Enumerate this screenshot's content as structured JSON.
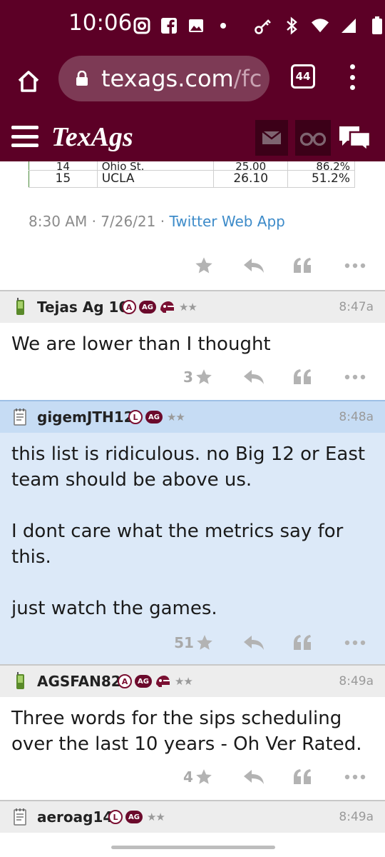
{
  "status_bar": {
    "time": "10:06",
    "left_icons": [
      "instagram-icon",
      "facebook-icon",
      "image-icon",
      "dot-icon"
    ],
    "right_icons": [
      "key-icon",
      "bluetooth-icon",
      "wifi-icon",
      "signal-icon",
      "battery-icon"
    ]
  },
  "browser": {
    "url_host": "texags.com",
    "url_path": "/fc",
    "tab_count": "44"
  },
  "app_bar": {
    "logo": "TexAgs"
  },
  "tweet": {
    "table_rows": [
      {
        "rank": "14",
        "team": "Ohio St.",
        "score": "25.00",
        "pct": "86.2%"
      },
      {
        "rank": "15",
        "team": "UCLA",
        "score": "26.10",
        "pct": "51.2%"
      }
    ],
    "timestamp": "8:30 AM · 7/26/21 · ",
    "source": "Twitter Web App"
  },
  "posts": [
    {
      "username": "Tejas Ag 10",
      "badge_letter": "A",
      "badge_ag": "AG",
      "stars": "★★",
      "time": "8:47a",
      "body": [
        "We are lower than I thought"
      ],
      "star_count": "3"
    },
    {
      "username": "gigemJTH12",
      "badge_letter": "L",
      "badge_ag": "AG",
      "stars": "★★",
      "time": "8:48a",
      "body": [
        "this list is ridiculous. no Big 12 or East team should be above us.",
        "I dont care what the metrics say for this.",
        "just watch the games."
      ],
      "star_count": "51"
    },
    {
      "username": "AGSFAN82",
      "badge_letter": "A",
      "badge_ag": "AG",
      "stars": "★★",
      "time": "8:49a",
      "body": [
        "Three words for the sips scheduling over the last 10 years - Oh Ver Rated."
      ],
      "star_count": "4"
    },
    {
      "username": "aeroag14",
      "badge_letter": "L",
      "badge_ag": "AG",
      "stars": "★★",
      "time": "8:49a"
    }
  ],
  "colors": {
    "maroon": "#5c0026",
    "highlight_post_bg": "#dce9f8",
    "header_bg": "#ededed",
    "highlight_header_bg": "#c6dcf4"
  }
}
